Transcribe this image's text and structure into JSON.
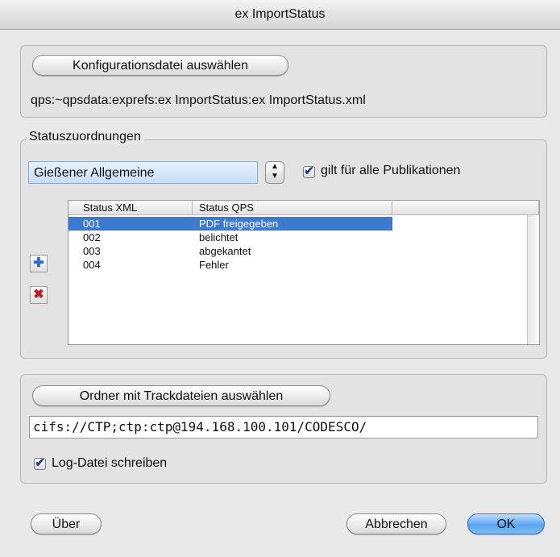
{
  "window": {
    "title": "ex ImportStatus"
  },
  "config": {
    "select_button": "Konfigurationsdatei auswählen",
    "path": "qps:~qpsdata:exprefs:ex ImportStatus:ex ImportStatus.xml"
  },
  "status_group": {
    "legend": "Statuszuordnungen",
    "publication_popup": "Gießener Allgemeine",
    "all_publications_checkbox": {
      "label": "gilt für alle Publikationen",
      "checked": true
    },
    "table": {
      "columns": [
        "Status XML",
        "Status QPS"
      ],
      "rows": [
        {
          "xml": "001",
          "qps": "PDF freigegeben",
          "selected": true
        },
        {
          "xml": "002",
          "qps": "belichtet",
          "selected": false
        },
        {
          "xml": "003",
          "qps": "abgekantet",
          "selected": false
        },
        {
          "xml": "004",
          "qps": "Fehler",
          "selected": false
        }
      ]
    },
    "add_icon": "plus-icon",
    "remove_icon": "x-icon"
  },
  "track": {
    "select_button": "Ordner mit Trackdateien auswählen",
    "path": "cifs://CTP;ctp:ctp@194.168.100.101/CODESCO/",
    "log_checkbox": {
      "label": "Log-Datei schreiben",
      "checked": true
    }
  },
  "footer": {
    "about": "Über",
    "cancel": "Abbrechen",
    "ok": "OK"
  },
  "colors": {
    "selection": "#3d78d1",
    "default_button": "#5aa6f0",
    "remove_red": "#c21c1c",
    "add_blue": "#2a6fd0"
  }
}
